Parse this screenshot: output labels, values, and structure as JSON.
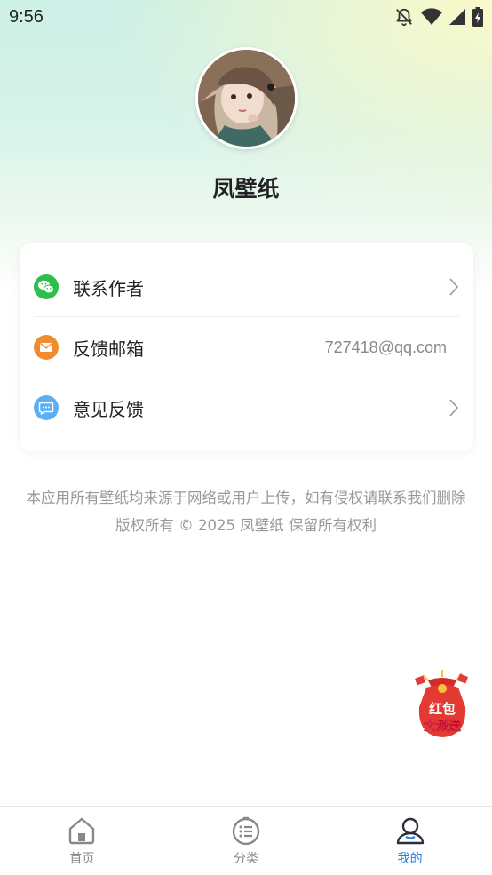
{
  "status_bar": {
    "time": "9:56",
    "icons": [
      "bell-off-icon",
      "wifi-icon",
      "signal-icon",
      "battery-charging-icon"
    ]
  },
  "profile": {
    "app_name": "凤壁纸"
  },
  "menu": {
    "items": [
      {
        "label": "联系作者",
        "icon": "wechat-icon",
        "icon_color": "#2dbe4c",
        "value": "",
        "has_chevron": true
      },
      {
        "label": "反馈邮箱",
        "icon": "mail-icon",
        "icon_color": "#f08c2e",
        "value": "727418@qq.com",
        "has_chevron": false
      },
      {
        "label": "意见反馈",
        "icon": "message-icon",
        "icon_color": "#5bb0f5",
        "value": "",
        "has_chevron": true
      }
    ]
  },
  "footer": {
    "disclaimer": "本应用所有壁纸均来源于网络或用户上传，如有侵权请联系我们删除",
    "copyright": "版权所有 © 2025 凤壁纸 保留所有权利"
  },
  "promo": {
    "text_line1": "红包",
    "text_line2": "大派送"
  },
  "tabbar": {
    "tabs": [
      {
        "label": "首页",
        "icon": "home-icon",
        "active": false
      },
      {
        "label": "分类",
        "icon": "category-icon",
        "active": false
      },
      {
        "label": "我的",
        "icon": "user-icon",
        "active": true
      }
    ]
  },
  "colors": {
    "accent": "#2f7de1",
    "text": "#222222",
    "muted": "#999999"
  }
}
